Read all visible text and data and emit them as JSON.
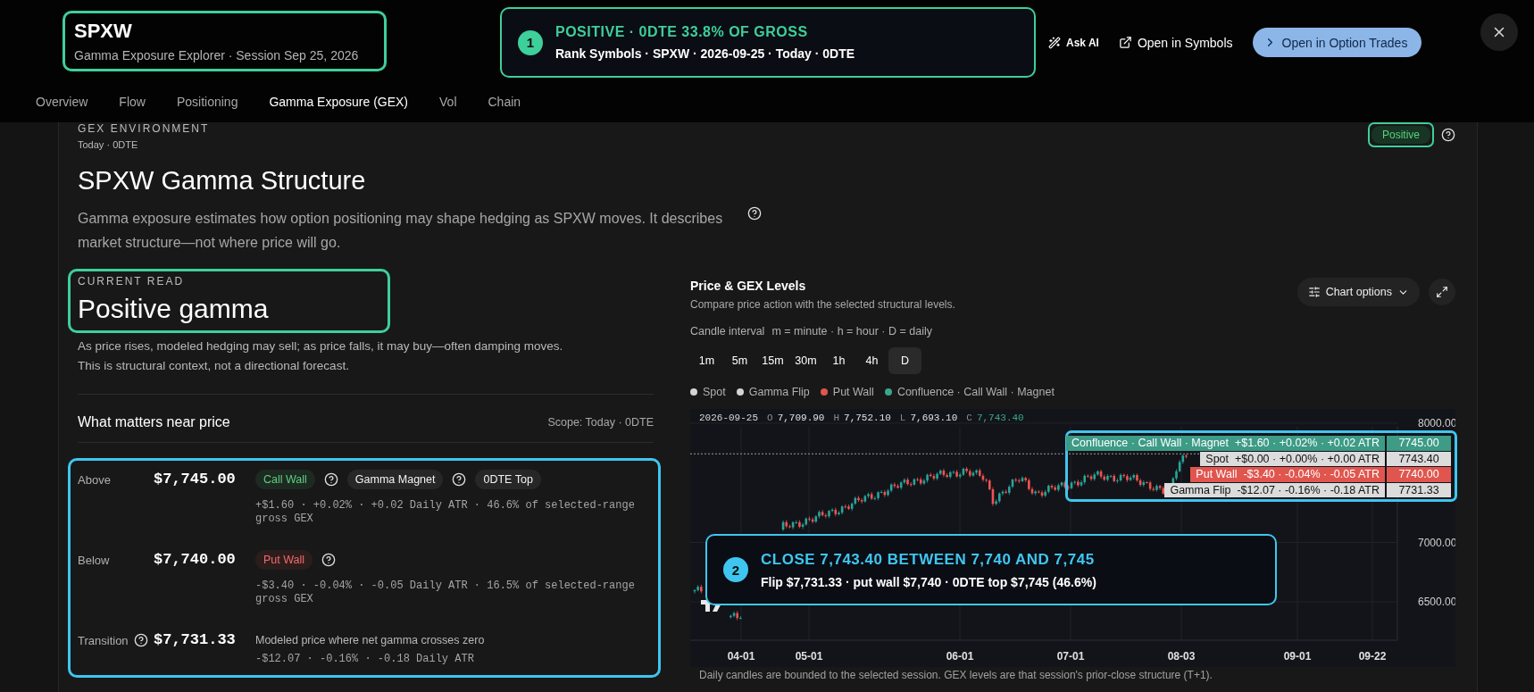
{
  "header": {
    "symbol": "SPXW",
    "subtitle": "Gamma Exposure Explorer · Session Sep 25, 2026",
    "callout": {
      "number": "1",
      "title": "POSITIVE · 0DTE 33.8% OF GROSS",
      "subtitle": "Rank Symbols · SPXW · 2026-09-25 · Today · 0DTE"
    }
  },
  "actions": [
    {
      "label": "Ask AI",
      "kind": "ai"
    },
    {
      "label": "Open in Symbols",
      "kind": "link"
    },
    {
      "label": "Open in Option Trades",
      "kind": "primary"
    }
  ],
  "tabs": [
    {
      "label": "Overview",
      "selected": false
    },
    {
      "label": "Flow",
      "selected": false
    },
    {
      "label": "Positioning",
      "selected": false
    },
    {
      "label": "Gamma Exposure (GEX)",
      "selected": true
    },
    {
      "label": "Vol",
      "selected": false
    },
    {
      "label": "Chain",
      "selected": false
    }
  ],
  "environment": {
    "eyebrow": "GEX ENVIRONMENT",
    "scope": "Today · 0DTE",
    "badge": "Positive",
    "title": "SPXW Gamma Structure",
    "description": "Gamma exposure estimates how option positioning may shape hedging as SPXW moves. It describes market structure—not where price will go."
  },
  "current_read": {
    "eyebrow": "CURRENT READ",
    "title": "Positive gamma",
    "lines": [
      "As price rises, modeled hedging may sell; as price falls, it may buy—often damping moves.",
      "This is structural context, not a directional forecast."
    ]
  },
  "levels_panel": {
    "title": "What matters near price",
    "scope": "Scope: Today · 0DTE",
    "rows": [
      {
        "label": "Above",
        "label_help": false,
        "price": "$7,745.00",
        "tags": [
          {
            "text": "Call Wall",
            "kind": "call",
            "help": true
          },
          {
            "text": "Gamma Magnet",
            "kind": "neutral",
            "help": true
          },
          {
            "text": "0DTE Top",
            "kind": "neutral",
            "help": false
          }
        ],
        "details": "+$1.60 · +0.02% · +0.02 Daily ATR · 46.6% of selected-range gross GEX"
      },
      {
        "label": "Below",
        "label_help": false,
        "price": "$7,740.00",
        "tags": [
          {
            "text": "Put Wall",
            "kind": "put",
            "help": true
          }
        ],
        "details": "-$3.40 · -0.04% · -0.05 Daily ATR · 16.5% of selected-range gross GEX"
      },
      {
        "label": "Transition",
        "label_help": true,
        "price": "$7,731.33",
        "note": "Modeled price where net gamma crosses zero",
        "details": "-$12.07 · -0.16% · -0.18 Daily ATR"
      }
    ]
  },
  "chart": {
    "title": "Price & GEX Levels",
    "subtitle": "Compare price action with the selected structural levels.",
    "options_label": "Chart options",
    "interval_label": "Candle interval",
    "interval_hint": "m = minute · h = hour · D = daily",
    "intervals": [
      {
        "label": "1m",
        "selected": false
      },
      {
        "label": "5m",
        "selected": false
      },
      {
        "label": "15m",
        "selected": false
      },
      {
        "label": "30m",
        "selected": false
      },
      {
        "label": "1h",
        "selected": false
      },
      {
        "label": "4h",
        "selected": false
      },
      {
        "label": "D",
        "selected": true
      }
    ],
    "legend": [
      {
        "label": "Spot",
        "color": "#d4d4d4"
      },
      {
        "label": "Gamma Flip",
        "color": "#d4d4d4"
      },
      {
        "label": "Put Wall",
        "color": "#e0564f"
      },
      {
        "label": "Confluence · Call Wall · Magnet",
        "color": "#3ca58d"
      }
    ],
    "ohlc": {
      "date": "2026-09-25",
      "fields": [
        {
          "key": "O",
          "value": "7,709.90",
          "kind": "plain"
        },
        {
          "key": "H",
          "value": "7,752.10",
          "kind": "plain"
        },
        {
          "key": "L",
          "value": "7,693.10",
          "kind": "plain"
        },
        {
          "key": "C",
          "value": "7,743.40",
          "kind": "close"
        }
      ]
    },
    "levels": [
      {
        "text": "Confluence · Call Wall · Magnet  +$1.60 · +0.02% · +0.02 ATR",
        "price": "7745.00",
        "color": "#3d9b86"
      },
      {
        "text": "Spot  +$0.00 · +0.00% · +0.00 ATR",
        "price": "7743.40",
        "color": "#dcdcdc"
      },
      {
        "text": "Put Wall  -$3.40 · -0.04% · -0.05 ATR",
        "price": "7740.00",
        "color": "#e0564f"
      },
      {
        "text": "Gamma Flip  -$12.07 · -0.16% · -0.18 ATR",
        "price": "7731.33",
        "color": "#dcdcdc"
      }
    ],
    "price_axis": [
      "8000.00",
      "7000.00",
      "6500.00"
    ],
    "date_axis": [
      "04-01",
      "05-01",
      "06-01",
      "07-01",
      "08-03",
      "09-01",
      "09-22"
    ],
    "callout": {
      "number": "2",
      "title": "CLOSE 7,743.40 BETWEEN 7,740 AND 7,745",
      "subtitle": "Flip $7,731.33 · put wall $7,740 · 0DTE top $7,745 (46.6%)"
    },
    "footnote": "Daily candles are bounded to the selected session. GEX levels are that session's prior-close structure (T+1)."
  }
}
